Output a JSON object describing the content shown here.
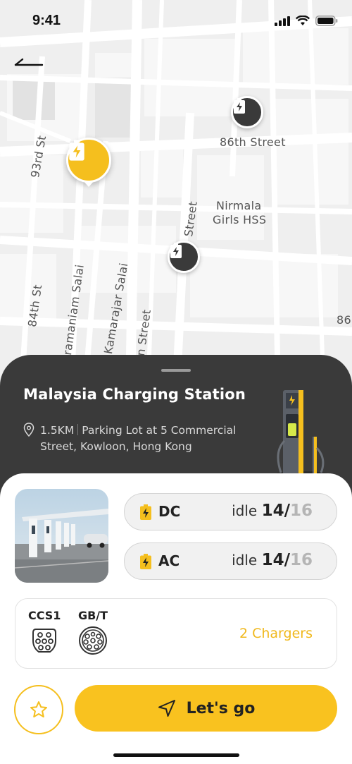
{
  "status": {
    "time": "9:41"
  },
  "map": {
    "streets": [
      "86th Street",
      "93rd St",
      "Nirmala",
      "Girls HSS",
      "Street",
      "84th St",
      "ramaniam Salai",
      "Kamarajar Salai",
      "n Street",
      "86"
    ]
  },
  "station": {
    "title": "Malaysia Charging Station",
    "distance": "1.5KM",
    "address": "Parking Lot at 5 Commercial Street, Kowloon, Hong Kong"
  },
  "ports": [
    {
      "type": "DC",
      "idle_label": "idle",
      "available": "14/",
      "total": "16"
    },
    {
      "type": "AC",
      "idle_label": "idle",
      "available": "14/",
      "total": "16"
    }
  ],
  "connectors": [
    {
      "name": "CCS1",
      "icon": "ccs1-connector-icon"
    },
    {
      "name": "GB/T",
      "icon": "gbt-connector-icon"
    }
  ],
  "chargers_label": "2 Chargers",
  "actions": {
    "go_label": "Let's go"
  },
  "colors": {
    "accent": "#f9c21f",
    "dark": "#3a3a3a"
  }
}
